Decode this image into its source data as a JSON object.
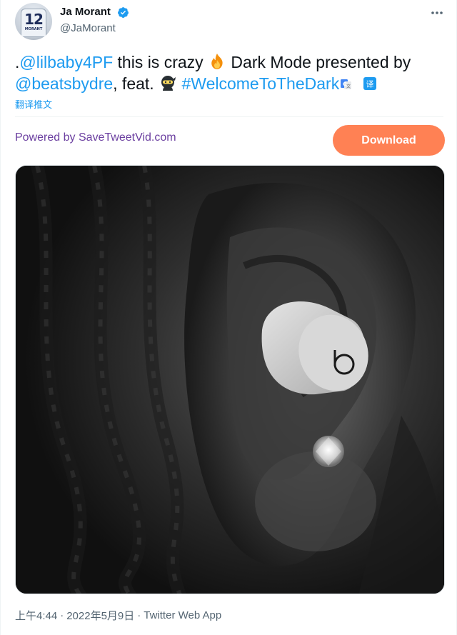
{
  "author": {
    "display_name": "Ja Morant",
    "handle": "@JaMorant",
    "avatar_jersey_number": "12",
    "avatar_jersey_name": "MORANT",
    "verified": true
  },
  "tweet": {
    "prefix": ".",
    "mention_1": "@lilbaby4PF",
    "text_1": " this is crazy ",
    "emoji_1": "fire-emoji",
    "text_2": " Dark Mode presented by ",
    "mention_2": "@beatsbydre",
    "text_3": ", feat. ",
    "emoji_2": "ninja-emoji",
    "hashtag": "#WelcomeToTheDark",
    "translate_link": "翻译推文"
  },
  "ad_bar": {
    "powered_by": "Powered by SaveTweetVid.com",
    "download_label": "Download"
  },
  "media": {
    "type": "video-thumbnail",
    "earbud_logo": "b"
  },
  "meta": {
    "time": "上午4:44",
    "separator": "·",
    "date": "2022年5月9日",
    "source": "Twitter Web App"
  },
  "colors": {
    "link": "#1d9bf0",
    "powered_by": "#6b3fa0",
    "download_bg": "#ff8154",
    "secondary_text": "#536471"
  }
}
